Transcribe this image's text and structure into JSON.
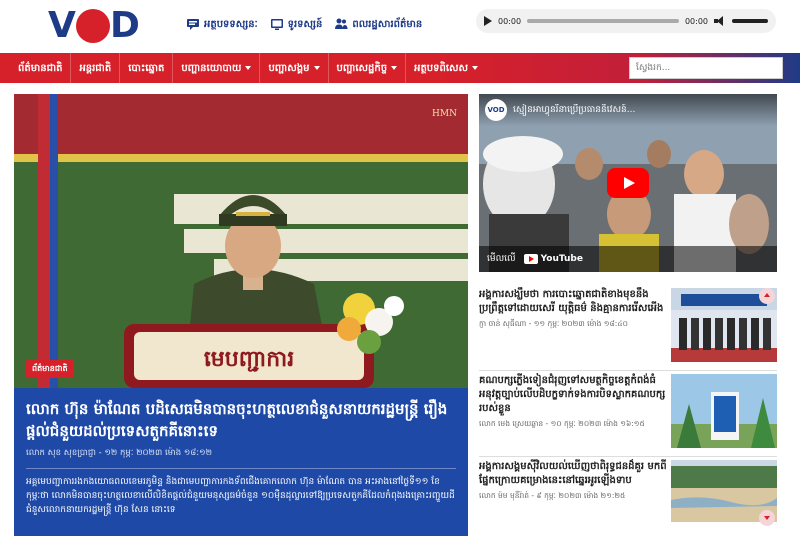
{
  "header": {
    "logo_text": "VOD",
    "links": [
      {
        "label": "អត្ថបទទស្សនៈ",
        "icon": "chat-icon"
      },
      {
        "label": "ទូរទស្សន៍",
        "icon": "tv-icon"
      },
      {
        "label": "ពលរដ្ឋសារព័ត៌មាន",
        "icon": "people-icon"
      }
    ],
    "audio": {
      "current_time": "00:00",
      "duration": "00:00"
    }
  },
  "nav": {
    "items": [
      {
        "label": "ព័ត៌មានជាតិ",
        "has_dropdown": false
      },
      {
        "label": "អន្តរជាតិ",
        "has_dropdown": false
      },
      {
        "label": "បោះឆ្នោត",
        "has_dropdown": false
      },
      {
        "label": "បញ្ហានយោបាយ",
        "has_dropdown": true
      },
      {
        "label": "បញ្ហាសង្គម",
        "has_dropdown": true
      },
      {
        "label": "បញ្ហាសេដ្ឋកិច្ច",
        "has_dropdown": true
      },
      {
        "label": "អត្ថបទពិសេស",
        "has_dropdown": true
      }
    ],
    "search_placeholder": "ស្វែងរក..."
  },
  "hero": {
    "badge": "ព័ត៌មានជាតិ",
    "watermark": "HMN",
    "banner_text": "មេបញ្ជាការ",
    "title": "លោក ហ៊ុន ម៉ាណែត បដិសេធមិនបានចុះហត្ថលេខាជំនួសនាយករដ្ឋមន្ត្រី រឿងផ្តល់ជំនួយដល់ប្រទេសតួកគីនោះទេ",
    "meta": "លោក សុខ សុខប្រាជ្ញា - ១២ កុម្ភៈ ២០២៣ ម៉ោង ១៨:១២",
    "excerpt": "អគ្គមេបញ្ជាការរងកងយោធពលខេមរភូមិន្ទ និងជាមេបញ្ជាការកងទ័ពជើងគោកលោក ហ៊ុន ម៉ាណែត បាន អះអាងនៅថ្ងៃទី១១ ខែកុម្ភៈថា លោកមិនបានចុះហត្ថលេខាលើលិខិតផ្តល់ជំនួយមនុស្សធម៌ចំនួន ១០ម៉ឺនដុល្លារទៅឱ្យប្រទេសតួកគីដែលកំពុងរងគ្រោះរញ្ជួយដី ជំនួសលោកនាយករដ្ឋមន្ត្រី ហ៊ុន សែន នោះទេ"
  },
  "video": {
    "channel_badge": "VOD",
    "title": "ស្មៀនអាហ្វុនរីនាប្រើប្រធាននិវេសន៍...",
    "watch_on_label": "មើលលើ",
    "platform": "YouTube"
  },
  "side_list": [
    {
      "title": "អង្គការសង្ឃឹមថា ការបោះឆ្នោតជាតិខាងមុខនឹងប្រព្រឹត្តទៅដោយសេរី យុត្តិធម៌ និងគ្មានការរើសអើង",
      "meta": "ក្ញា ចាន់ សុធីណា - ១១ កុម្ភៈ ២០២៣ ម៉ោង ១៨:៤០"
    },
    {
      "title": "គណបក្សភ្លើងទៀនជំរុញទៅសមត្ថកិច្ចខេត្តកំពង់ធំ អនុវត្តច្បាប់លើបដិបក្ខទាក់ទងការបិទស្លាកគណបក្សរបស់ខ្លួន",
      "meta": "លោក មេង ស្រេយឆ្លាន - ១០ កុម្ភៈ ២០២៣ ម៉ោង ១៦:១៥"
    },
    {
      "title": "អង្គការសង្គមស៊ីវិលយល់ឃើញថាពិរុទ្ធជនដ៏គួរ មកពីផ្នែកក្រោយគម្រោងនេះនៅឆ្នេរអូរឡើងទាប",
      "meta": "លោក ម៉ម មុនីរ៉ាត់ - ៩ កុម្ភៈ ២០២៣ ម៉ោង ២១:២៥"
    }
  ],
  "colors": {
    "brand_blue": "#1e3b88",
    "brand_red": "#d6202a",
    "caption_blue": "#1f49a6"
  }
}
